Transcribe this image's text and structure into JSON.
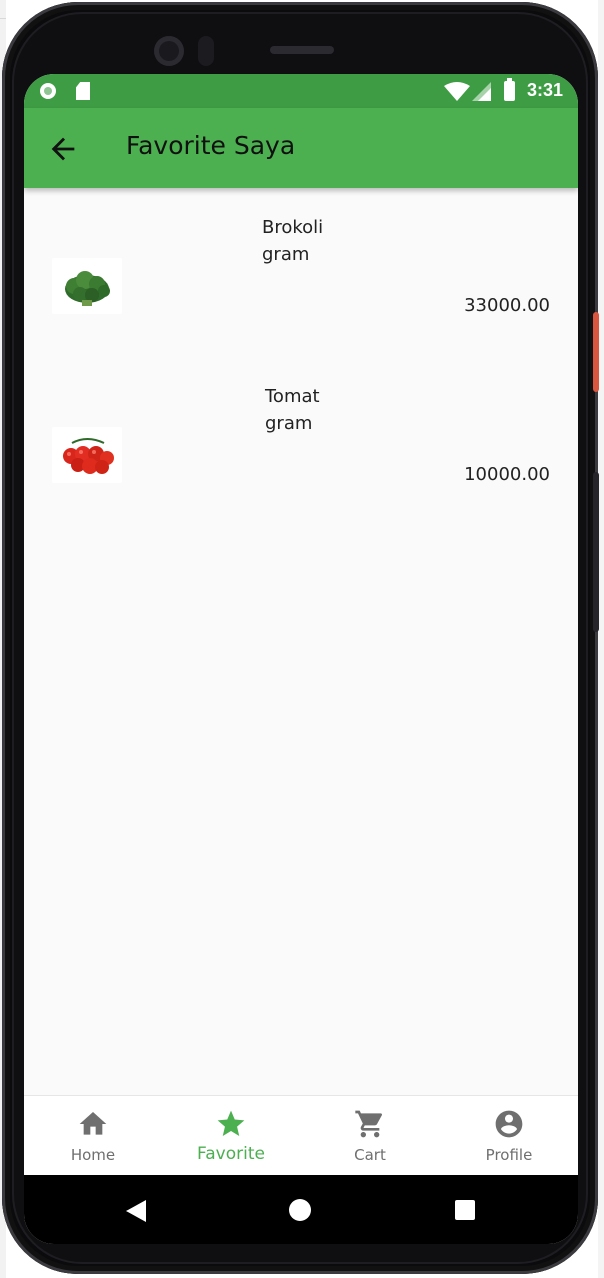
{
  "status_bar": {
    "time": "3:31"
  },
  "app_bar": {
    "title": "Favorite Saya"
  },
  "favorites": [
    {
      "name": "Brokoli",
      "unit": "gram",
      "price": "33000.00",
      "image_icon": "broccoli-image"
    },
    {
      "name": "Tomat",
      "unit": "gram",
      "price": "10000.00",
      "image_icon": "tomato-image"
    }
  ],
  "bottom_nav": {
    "items": [
      {
        "label": "Home",
        "icon": "home-icon",
        "active": false
      },
      {
        "label": "Favorite",
        "icon": "star-icon",
        "active": true
      },
      {
        "label": "Cart",
        "icon": "cart-icon",
        "active": false
      },
      {
        "label": "Profile",
        "icon": "profile-icon",
        "active": false
      }
    ]
  },
  "colors": {
    "primary": "#4caf50",
    "status_bar": "#3e9d44",
    "inactive": "#6f6f6f",
    "background": "#fafafa"
  }
}
